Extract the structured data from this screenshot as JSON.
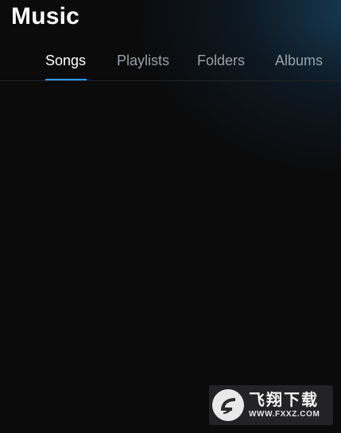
{
  "header": {
    "title": "Music"
  },
  "tabs": [
    {
      "label": "Songs",
      "active": true
    },
    {
      "label": "Playlists",
      "active": false
    },
    {
      "label": "Folders",
      "active": false
    },
    {
      "label": "Albums",
      "active": false
    }
  ],
  "colors": {
    "background": "#0b0b0c",
    "accent": "#2e9bf0",
    "inactive_tab_text": "#9aa0a6",
    "active_tab_text": "#ffffff"
  },
  "watermark": {
    "logo_icon": "fxxz-logo-icon",
    "text_cn": "飞翔下载",
    "url": "WWW.FXXZ.COM"
  }
}
